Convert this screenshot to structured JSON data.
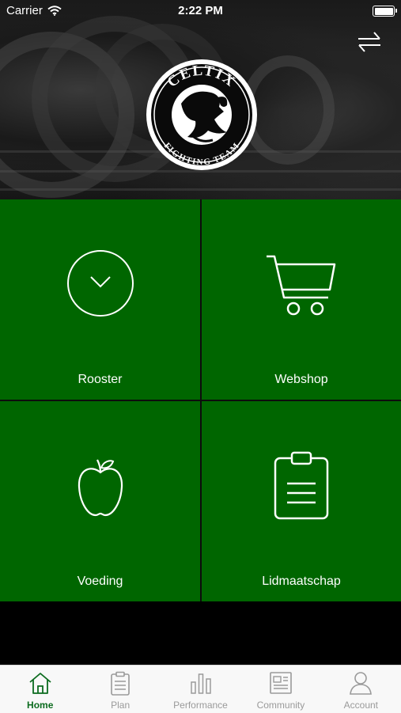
{
  "status_bar": {
    "carrier": "Carrier",
    "time": "2:22 PM"
  },
  "header": {
    "logo_top_text": "CELTIX",
    "logo_bottom_text": "FIGHTING TEAM",
    "swap_icon": "swap-arrows-icon"
  },
  "tiles": [
    {
      "label": "Rooster",
      "icon": "clock-icon"
    },
    {
      "label": "Webshop",
      "icon": "shopping-cart-icon"
    },
    {
      "label": "Voeding",
      "icon": "apple-icon"
    },
    {
      "label": "Lidmaatschap",
      "icon": "clipboard-icon"
    }
  ],
  "tab_bar": {
    "active": "Home",
    "active_color": "#0b6b1e",
    "items": [
      {
        "label": "Home",
        "icon": "home-icon"
      },
      {
        "label": "Plan",
        "icon": "clipboard-icon"
      },
      {
        "label": "Performance",
        "icon": "bar-chart-icon"
      },
      {
        "label": "Community",
        "icon": "newsfeed-icon"
      },
      {
        "label": "Account",
        "icon": "user-icon"
      }
    ]
  },
  "colors": {
    "tile_green": "#006600",
    "tab_inactive": "#9a9a9a"
  }
}
